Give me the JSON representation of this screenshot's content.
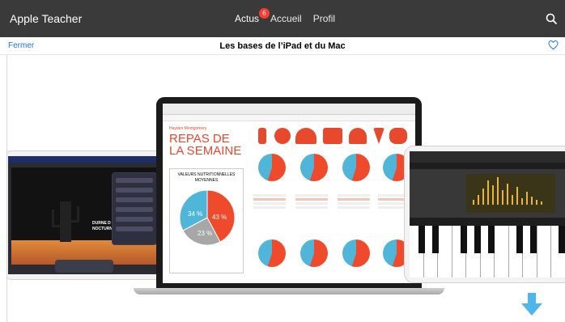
{
  "app": {
    "title": "Apple Teacher",
    "nav": [
      {
        "label": "Actus",
        "badge": "6"
      },
      {
        "label": "Accueil"
      },
      {
        "label": "Profil"
      }
    ]
  },
  "subheader": {
    "close_label": "Fermer",
    "title": "Les bases de l’iPad et du Mac"
  },
  "hero": {
    "numbers_doc": {
      "author": "Hayden Montgomery",
      "heading_line1": "REPAS DE",
      "heading_line2": "LA SEMAINE",
      "nutrition_title_line1": "VALEURS NUTRITIONNELLES",
      "nutrition_title_line2": "MOYENNES",
      "pie_values": [
        "34 %",
        "43 %",
        "23 %"
      ]
    },
    "keynote_slide_text_line1": "DURNE D",
    "keynote_slide_text_line2": "NOCTURNE"
  },
  "colors": {
    "appbar": "#3a3a3a",
    "link": "#1a73e8",
    "badge": "#ff3b30",
    "accent_red": "#e8482c",
    "accent_blue": "#4fb5d9",
    "download_arrow": "#4fb5ea"
  },
  "icons": {
    "search": "search-icon",
    "favorite": "heart-icon",
    "download": "download-icon"
  }
}
